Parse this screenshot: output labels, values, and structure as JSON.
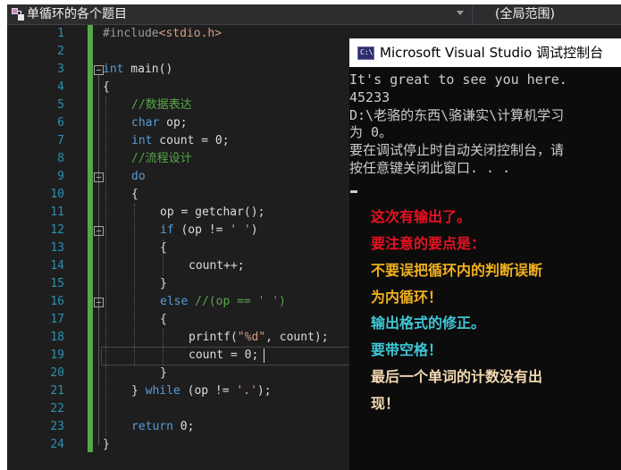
{
  "navbar": {
    "scope_label": "单循环的各个题目",
    "member_label": "(全局范围)"
  },
  "line_numbers": [
    "1",
    "2",
    "3",
    "4",
    "5",
    "6",
    "7",
    "8",
    "9",
    "10",
    "11",
    "12",
    "13",
    "14",
    "15",
    "16",
    "17",
    "18",
    "19",
    "20",
    "21",
    "22",
    "23",
    "24"
  ],
  "code": {
    "l1_directive": "#include",
    "l1_header": "<stdio.h>",
    "l3_int": "int",
    "l3_rest": " main()",
    "l4": "{",
    "l5": "//数据表达",
    "l6_type": "char",
    "l6_rest": " op;",
    "l7_type": "int",
    "l7_rest": " count = 0;",
    "l8": "//流程设计",
    "l9": "do",
    "l10": "{",
    "l11": "op = getchar();",
    "l12_kw": "if",
    "l12_a": " (op != ",
    "l12_str": "' '",
    "l12_b": ")",
    "l13": "{",
    "l14": "count++;",
    "l15": "}",
    "l16_kw": "else",
    "l16_comment": " //(op == ' ')",
    "l17": "{",
    "l18_a": "printf(",
    "l18_str": "\"%d\"",
    "l18_b": ", count);",
    "l19": "count = 0;",
    "l20": "}",
    "l21_a": "} ",
    "l21_kw": "while",
    "l21_b": " (op != ",
    "l21_str": "'.'",
    "l21_c": ");",
    "l23_kw": "return",
    "l23_rest": " 0;",
    "l24": "}"
  },
  "console": {
    "title": "Microsoft Visual Studio 调试控制台",
    "icon_label": "C:\\",
    "lines": [
      "It's great to see you here.",
      "45233",
      "D:\\老骆的东西\\骆谦实\\计算机学习",
      "为 0。",
      "要在调试停止时自动关闭控制台，请",
      "按任意键关闭此窗口. . ."
    ]
  },
  "notes": [
    {
      "text": "这次有输出了。",
      "color": "#e81123"
    },
    {
      "text": "要注意的要点是：",
      "color": "#e81123"
    },
    {
      "text": "不要误把循环内的判断误断",
      "color": "#f0b01e"
    },
    {
      "text": "为内循环！",
      "color": "#f0b01e"
    },
    {
      "text": "输出格式的修正。",
      "color": "#3fc6d4"
    },
    {
      "text": "要带空格！",
      "color": "#3fc6d4"
    },
    {
      "text": "最后一个单词的计数没有出",
      "color": "#f3d9b1"
    },
    {
      "text": "现！",
      "color": "#f3d9b1"
    }
  ]
}
